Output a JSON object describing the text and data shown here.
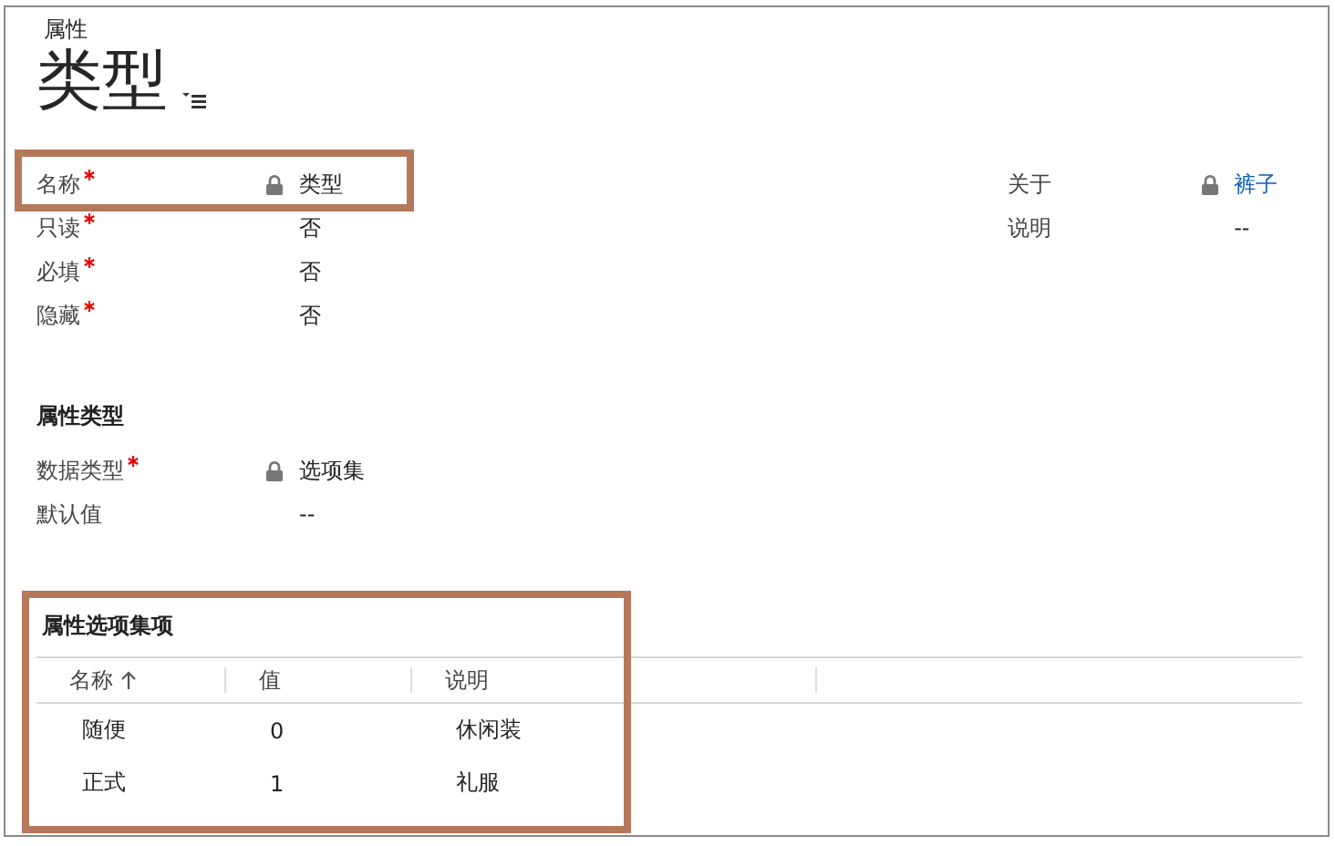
{
  "header": {
    "entity": "属性",
    "title": "类型"
  },
  "fields_left": [
    {
      "label": "名称",
      "required": true,
      "locked": true,
      "value": "类型",
      "highlighted": true
    },
    {
      "label": "只读",
      "required": true,
      "locked": false,
      "value": "否",
      "highlighted": false
    },
    {
      "label": "必填",
      "required": true,
      "locked": false,
      "value": "否",
      "highlighted": false
    },
    {
      "label": "隐藏",
      "required": true,
      "locked": false,
      "value": "否",
      "highlighted": false
    }
  ],
  "fields_right": [
    {
      "label": "关于",
      "required": false,
      "locked": true,
      "value": "裤子",
      "link": true
    },
    {
      "label": "说明",
      "required": false,
      "locked": false,
      "value": "--",
      "link": false
    }
  ],
  "section": {
    "title": "属性类型",
    "fields": [
      {
        "label": "数据类型",
        "required": true,
        "locked": true,
        "value": "选项集"
      },
      {
        "label": "默认值",
        "required": false,
        "locked": false,
        "value": "--"
      }
    ]
  },
  "options": {
    "title": "属性选项集项",
    "highlighted": true,
    "columns": [
      {
        "label": "名称",
        "sorted": true
      },
      {
        "label": "值",
        "sorted": false
      },
      {
        "label": "说明",
        "sorted": false
      }
    ],
    "rows": [
      [
        "随便",
        "0",
        "休闲装"
      ],
      [
        "正式",
        "1",
        "礼服"
      ]
    ]
  }
}
